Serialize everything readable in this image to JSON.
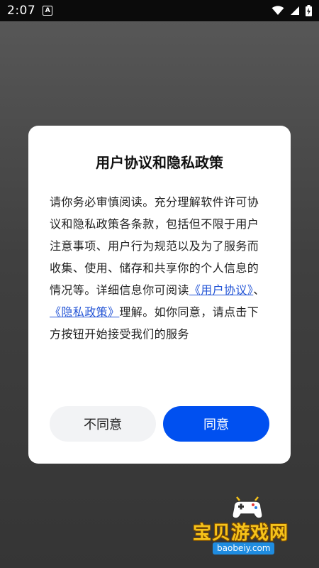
{
  "status_bar": {
    "time": "2:07"
  },
  "dialog": {
    "title": "用户协议和隐私政策",
    "body_part1": "请你务必审慎阅读。充分理解软件许可协议和隐私政策各条款，包括但不限于用户注意事项、用户行为规范以及为了服务而收集、使用、储存和共享你的个人信息的情况等。详细信息你可阅读",
    "link_user_agreement": "《用户协议》",
    "separator": "、",
    "link_privacy_policy": "《隐私政策》",
    "body_part2": "理解。如你同意，请点击下方按钮开始接受我们的服务",
    "disagree_label": "不同意",
    "agree_label": "同意"
  },
  "watermark": {
    "name": "宝贝游戏网",
    "url": "baobeiy.com"
  },
  "colors": {
    "primary": "#0050f0",
    "link": "#2455d6",
    "secondary_button": "#f2f3f5"
  }
}
